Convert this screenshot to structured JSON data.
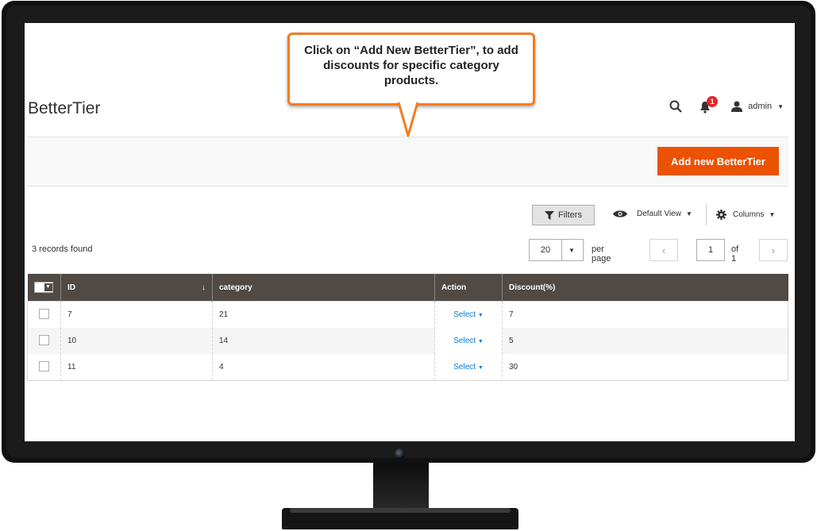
{
  "header": {
    "page_title": "BetterTier",
    "notification_count": "1",
    "user_name": "admin"
  },
  "actions": {
    "add_button_label": "Add new BetterTier"
  },
  "callout": {
    "text": "Click on “Add New BetterTier”, to add discounts for specific category products."
  },
  "toolbar": {
    "filters_label": "Filters",
    "view_label": "Default View",
    "columns_label": "Columns"
  },
  "records_found": "3 records found",
  "pagination": {
    "per_page_value": "20",
    "per_page_label": "per page",
    "current_page": "1",
    "of_pages": "of 1"
  },
  "grid": {
    "columns": [
      "ID",
      "category",
      "Action",
      "Discount(%)"
    ],
    "rows": [
      {
        "id": "7",
        "category": "21",
        "action": "Select",
        "discount": "7"
      },
      {
        "id": "10",
        "category": "14",
        "action": "Select",
        "discount": "5"
      },
      {
        "id": "11",
        "category": "4",
        "action": "Select",
        "discount": "30"
      }
    ]
  },
  "colors": {
    "accent": "#eb5202",
    "header_bg": "#514943",
    "link": "#007bdb",
    "callout_border": "#f47b20"
  }
}
